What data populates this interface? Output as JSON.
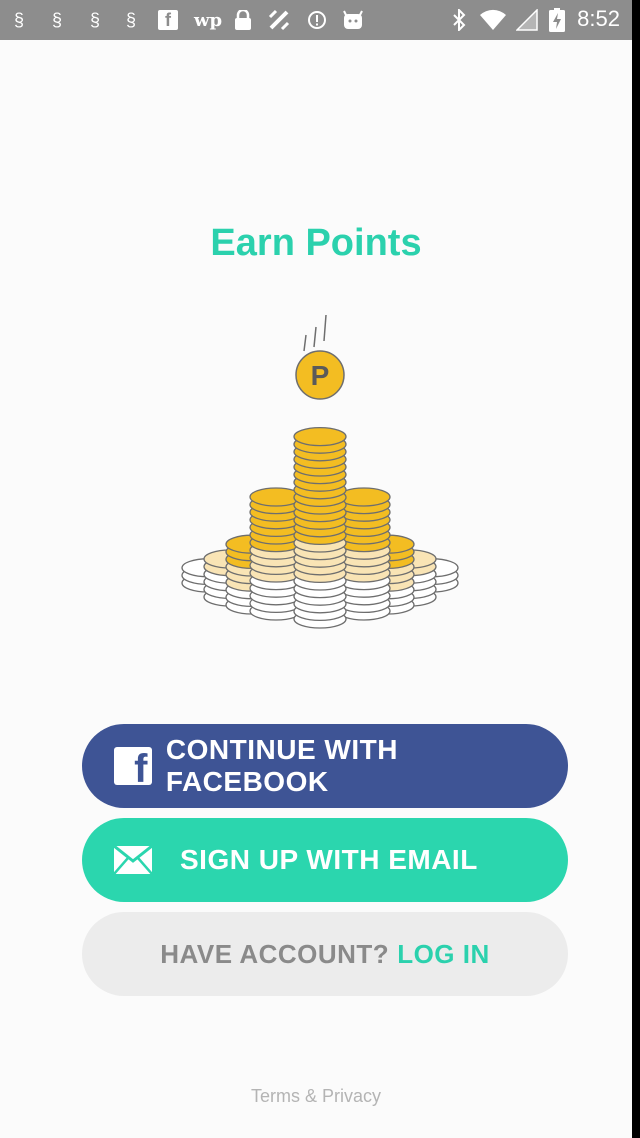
{
  "status_bar": {
    "time": "8:52",
    "icons": [
      "notification-icon",
      "notification-icon",
      "notification-icon",
      "notification-icon",
      "facebook-icon",
      "washington-post-icon",
      "lock-icon",
      "satellite-icon",
      "info-icon",
      "android-icon",
      "bluetooth-icon",
      "wifi-icon",
      "signal-icon",
      "battery-charging-icon"
    ],
    "fb_glyph": "f",
    "wp_glyph": "wp"
  },
  "main": {
    "title": "Earn Points",
    "coin_letter": "P"
  },
  "buttons": {
    "facebook": {
      "label": "CONTINUE WITH FACEBOOK",
      "icon": "facebook-icon",
      "icon_glyph": "f"
    },
    "email": {
      "label": "SIGN UP WITH EMAIL",
      "icon": "mail-icon"
    },
    "login": {
      "prefix": "HAVE ACCOUNT?",
      "link": "LOG IN"
    }
  },
  "footer": {
    "text": "Terms & Privacy"
  },
  "colors": {
    "accent": "#2bd1ad",
    "facebook": "#3e5495",
    "coin_gold": "#f3bd22",
    "coin_pale": "#f9e4b5"
  }
}
